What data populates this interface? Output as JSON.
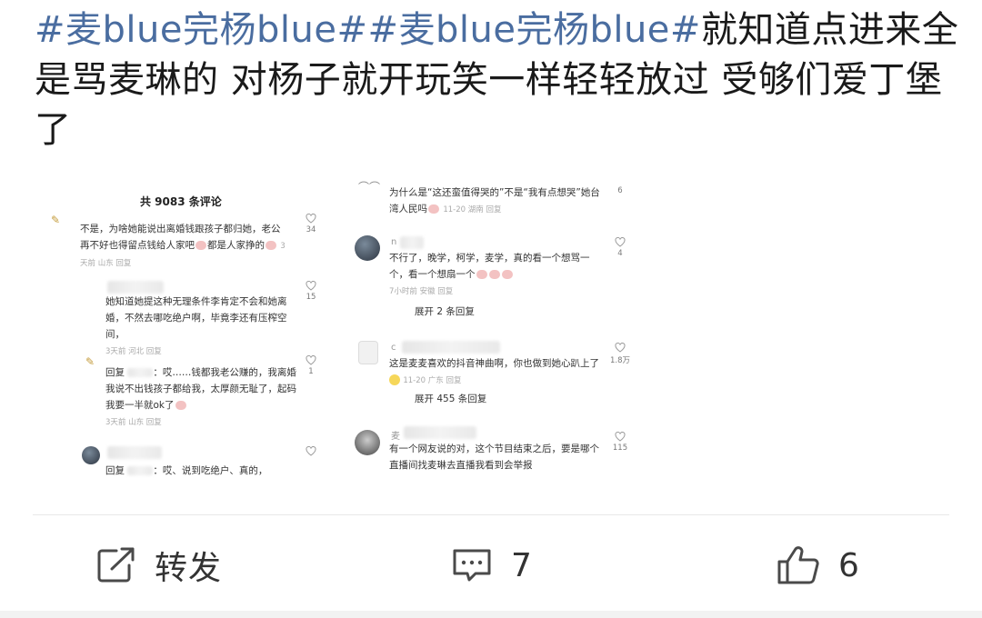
{
  "post": {
    "hashtag_1": "#麦blue完杨blue#",
    "hashtag_2": "#麦blue完杨blue#",
    "body": "就知道点进来全是骂麦琳的 对杨子就开玩笑一样轻轻放过 受够们爱丁堡了"
  },
  "embed": {
    "comment_count_title": "共 9083 条评论",
    "left_comments": [
      {
        "text": "不是，为啥她能说出离婚钱跟孩子都归她，老公再不好也得留点钱给人家吧",
        "text_2": "都是人家挣的",
        "meta": "3天前 山东 回复",
        "likes": "34"
      },
      {
        "text": "她知道她提这种无理条件李肯定不会和她离婚，不然去哪吃绝户啊，毕竟李还有压榨空间，",
        "meta": "3天前 河北 回复",
        "likes": "15"
      },
      {
        "reply_prefix": "回复",
        "text": "：哎……钱都我老公赚的，我离婚我说不出钱孩子都给我，太厚颜无耻了，起码我要一半就ok了",
        "meta": "3天前 山东 回复",
        "likes": "1"
      },
      {
        "reply_prefix": "回复",
        "text": "：哎、说到吃绝户、真的，",
        "likes": ""
      }
    ],
    "right_comments": [
      {
        "text": "为什么是“这还蛮值得哭的”不是“我有点想哭”她台湾人民吗",
        "meta": "11-20 湖南 回复",
        "likes": "6"
      },
      {
        "username": "n",
        "text": "不行了，晚学，柯学，麦学，真的看一个想骂一个，看一个想扇一个",
        "meta": "7小时前 安徽 回复",
        "likes": "4",
        "expand": "展开 2 条回复"
      },
      {
        "username": "c",
        "text": "这是麦麦喜欢的抖音神曲啊，你也做到她心趴上了",
        "meta": "11-20 广东 回复",
        "likes": "1.8万",
        "expand": "展开 455 条回复"
      },
      {
        "username": "麦",
        "text": "有一个网友说的对，这个节目结束之后，要是哪个直播间找麦琳去直播我看到会举报",
        "likes": "115"
      }
    ]
  },
  "actions": {
    "repost_label": "转发",
    "comment_count": "7",
    "like_count": "6"
  },
  "icons": {
    "repost": "share-square-icon",
    "comment": "comment-bubble-icon",
    "like": "thumbs-up-icon",
    "heart": "heart-outline-icon"
  },
  "colors": {
    "hashtag": "#4a6da0",
    "text": "#1a1a1a"
  }
}
